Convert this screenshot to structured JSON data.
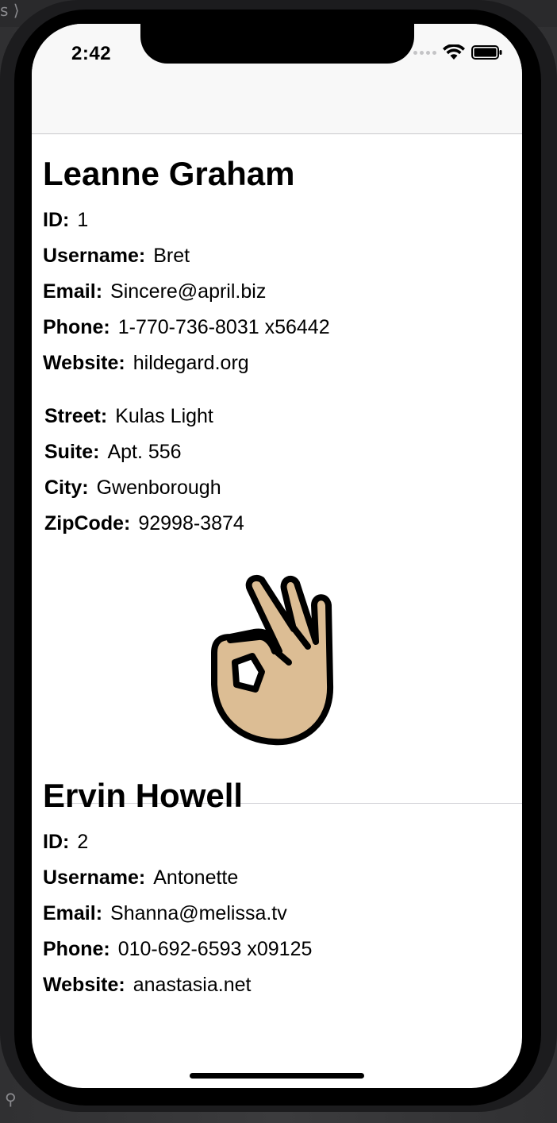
{
  "status_bar": {
    "time": "2:42"
  },
  "users": [
    {
      "name": "Leanne Graham",
      "fields": [
        {
          "label": "ID:",
          "value": "1"
        },
        {
          "label": "Username:",
          "value": "Bret"
        },
        {
          "label": "Email:",
          "value": "Sincere@april.biz"
        },
        {
          "label": "Phone:",
          "value": "1-770-736-8031 x56442"
        },
        {
          "label": "Website:",
          "value": "hildegard.org"
        }
      ],
      "address": [
        {
          "label": "Street:",
          "value": "Kulas Light"
        },
        {
          "label": "Suite:",
          "value": "Apt. 556"
        },
        {
          "label": "City:",
          "value": "Gwenborough"
        },
        {
          "label": "ZipCode:",
          "value": "92998-3874"
        }
      ],
      "emoji": "ok-hand-icon"
    },
    {
      "name": "Ervin Howell",
      "fields": [
        {
          "label": "ID:",
          "value": "2"
        },
        {
          "label": "Username:",
          "value": "Antonette"
        },
        {
          "label": "Email:",
          "value": "Shanna@melissa.tv"
        },
        {
          "label": "Phone:",
          "value": "010-692-6593 x09125"
        },
        {
          "label": "Website:",
          "value": "anastasia.net"
        }
      ]
    }
  ],
  "colors": {
    "skin_tone": "#dcbd94",
    "outline": "#000000",
    "nav_background": "#f8f8f8",
    "separator": "#d1d1d6"
  }
}
